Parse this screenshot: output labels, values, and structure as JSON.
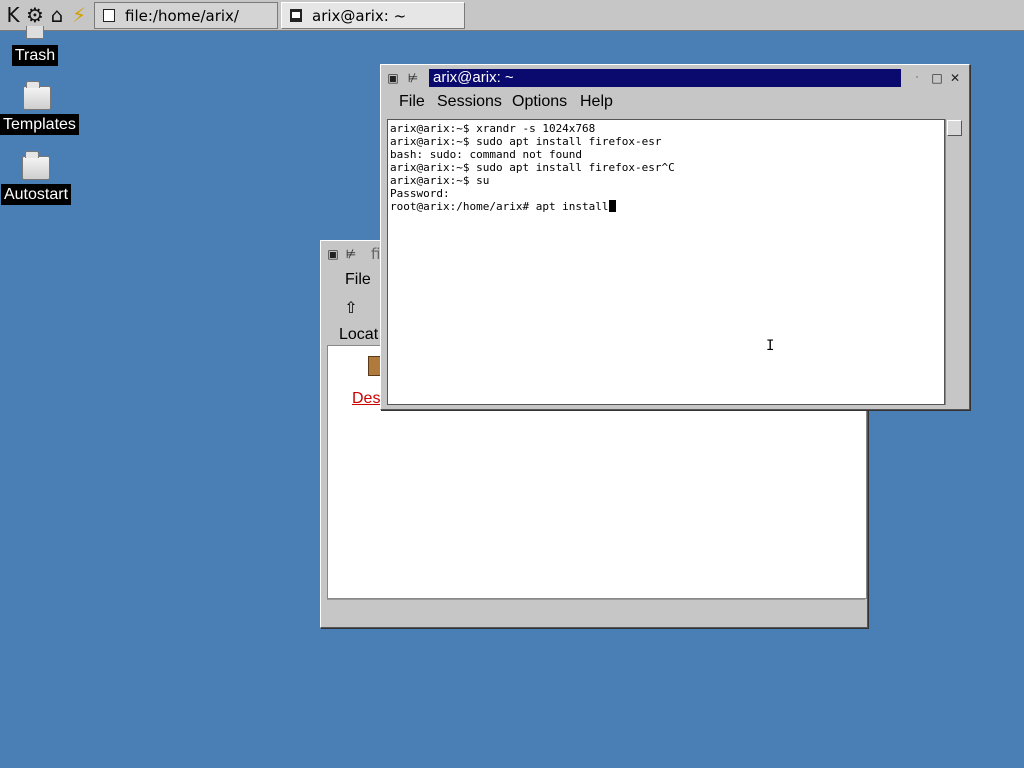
{
  "taskbar": {
    "launchers": [
      {
        "icon": "kde-k-icon",
        "glyph": "K"
      },
      {
        "icon": "kmenu-icon",
        "glyph": "⚙"
      },
      {
        "icon": "home-folder-icon",
        "glyph": "⌂"
      },
      {
        "icon": "konqueror-icon",
        "glyph": "⚡"
      }
    ],
    "tasks": [
      {
        "label": "file:/home/arix/",
        "icon": "document-icon"
      },
      {
        "label": "arix@arix: ~",
        "icon": "terminal-icon"
      }
    ]
  },
  "desktop": {
    "icons": [
      {
        "label": "Trash",
        "icon": "trash-icon"
      },
      {
        "label": "Templates",
        "icon": "folder-icon"
      },
      {
        "label": "Autostart",
        "icon": "folder-icon"
      }
    ]
  },
  "file_manager": {
    "title_visible": "fi",
    "menu_file": "File",
    "up_glyph": "⇧",
    "location_label": "Locat",
    "item_label": "Des"
  },
  "terminal_window": {
    "title": "arix@arix: ~",
    "menus": [
      "File",
      "Sessions",
      "Options",
      "Help"
    ],
    "lines": [
      "arix@arix:~$ xrandr -s 1024x768",
      "arix@arix:~$ sudo apt install firefox-esr",
      "bash: sudo: command not found",
      "arix@arix:~$ sudo apt install firefox-esr^C",
      "arix@arix:~$ su",
      "Password:",
      "root@arix:/home/arix# apt install"
    ]
  },
  "colors": {
    "desktop": "#4a7fb5",
    "titlebar_active": "#0a0a6e",
    "link": "#cc0000"
  }
}
